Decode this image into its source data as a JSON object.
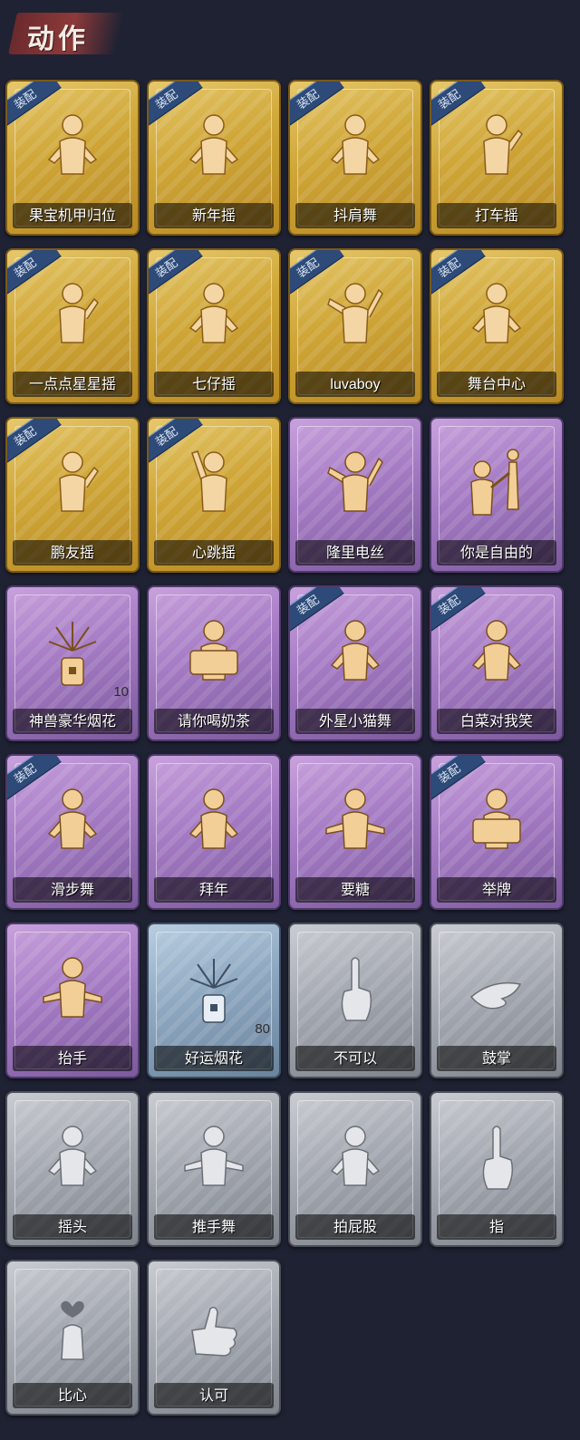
{
  "header": {
    "title": "动作"
  },
  "cards": [
    {
      "label": "果宝机甲归位",
      "tier": "gold",
      "equipped": true,
      "badge": "装配",
      "pose": "hands-hips"
    },
    {
      "label": "新年摇",
      "tier": "gold",
      "equipped": true,
      "badge": "装配",
      "pose": "wave"
    },
    {
      "label": "抖肩舞",
      "tier": "gold",
      "equipped": true,
      "badge": "装配",
      "pose": "shrug"
    },
    {
      "label": "打车摇",
      "tier": "gold",
      "equipped": true,
      "badge": "装配",
      "pose": "hand-up"
    },
    {
      "label": "一点点星星摇",
      "tier": "gold",
      "equipped": true,
      "badge": "装配",
      "pose": "point"
    },
    {
      "label": "七仔摇",
      "tier": "gold",
      "equipped": true,
      "badge": "装配",
      "pose": "arm-cross"
    },
    {
      "label": "luvaboy",
      "tier": "gold",
      "equipped": true,
      "badge": "装配",
      "pose": "dab"
    },
    {
      "label": "舞台中心",
      "tier": "gold",
      "equipped": true,
      "badge": "装配",
      "pose": "hand-chin"
    },
    {
      "label": "鹏友摇",
      "tier": "gold",
      "equipped": true,
      "badge": "装配",
      "pose": "point"
    },
    {
      "label": "心跳摇",
      "tier": "gold",
      "equipped": true,
      "badge": "装配",
      "pose": "arm-raise"
    },
    {
      "label": "隆里电丝",
      "tier": "purple",
      "equipped": false,
      "badge": "",
      "pose": "dab"
    },
    {
      "label": "你是自由的",
      "tier": "purple",
      "equipped": false,
      "badge": "",
      "pose": "duo"
    },
    {
      "label": "神兽豪华烟花",
      "tier": "purple",
      "equipped": false,
      "badge": "",
      "pose": "fireworks",
      "count": "10"
    },
    {
      "label": "请你喝奶茶",
      "tier": "purple",
      "equipped": false,
      "badge": "",
      "pose": "sign"
    },
    {
      "label": "外星小猫舞",
      "tier": "purple",
      "equipped": true,
      "badge": "装配",
      "pose": "arm-cross"
    },
    {
      "label": "白菜对我笑",
      "tier": "purple",
      "equipped": true,
      "badge": "装配",
      "pose": "hands-chest"
    },
    {
      "label": "滑步舞",
      "tier": "purple",
      "equipped": true,
      "badge": "装配",
      "pose": "shrug"
    },
    {
      "label": "拜年",
      "tier": "purple",
      "equipped": false,
      "badge": "",
      "pose": "bow"
    },
    {
      "label": "要糖",
      "tier": "purple",
      "equipped": false,
      "badge": "",
      "pose": "reach"
    },
    {
      "label": "举牌",
      "tier": "purple",
      "equipped": true,
      "badge": "装配",
      "pose": "sign"
    },
    {
      "label": "抬手",
      "tier": "purple",
      "equipped": false,
      "badge": "",
      "pose": "reach"
    },
    {
      "label": "好运烟花",
      "tier": "blue",
      "equipped": false,
      "badge": "",
      "pose": "fireworks",
      "count": "80"
    },
    {
      "label": "不可以",
      "tier": "grey",
      "equipped": false,
      "badge": "",
      "pose": "finger"
    },
    {
      "label": "鼓掌",
      "tier": "grey",
      "equipped": false,
      "badge": "",
      "pose": "clap"
    },
    {
      "label": "摇头",
      "tier": "grey",
      "equipped": false,
      "badge": "",
      "pose": "wave"
    },
    {
      "label": "推手舞",
      "tier": "grey",
      "equipped": false,
      "badge": "",
      "pose": "push"
    },
    {
      "label": "拍屁股",
      "tier": "grey",
      "equipped": false,
      "badge": "",
      "pose": "bow"
    },
    {
      "label": "指",
      "tier": "grey",
      "equipped": false,
      "badge": "",
      "pose": "finger"
    },
    {
      "label": "比心",
      "tier": "grey",
      "equipped": false,
      "badge": "",
      "pose": "heart"
    },
    {
      "label": "认可",
      "tier": "grey",
      "equipped": false,
      "badge": "",
      "pose": "thumb"
    }
  ]
}
